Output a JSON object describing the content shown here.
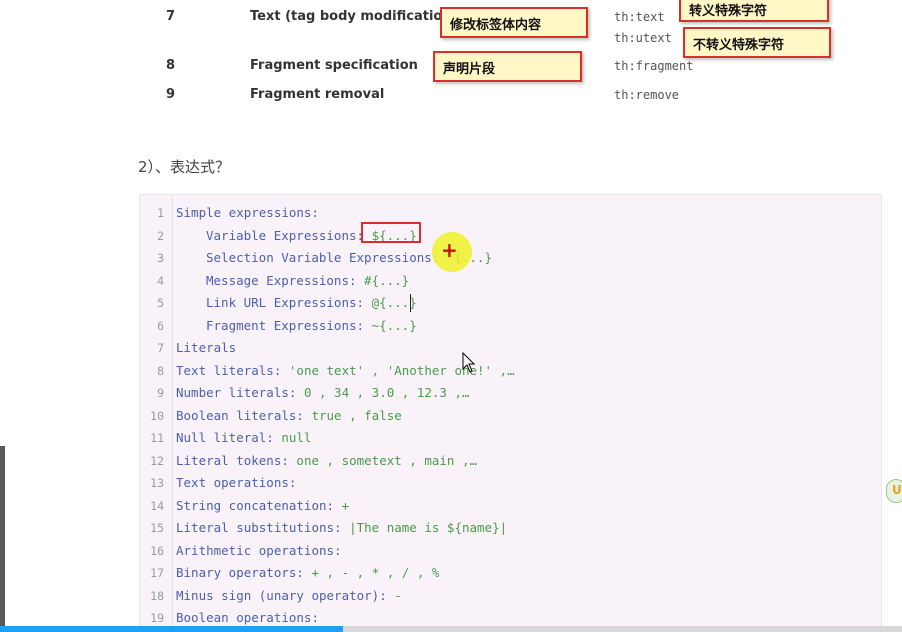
{
  "table": {
    "rows": [
      {
        "num": "7",
        "feature": "Text (tag body modification)",
        "attrs": [
          "th:text",
          "th:utext"
        ]
      },
      {
        "num": "8",
        "feature": "Fragment specification",
        "attrs": [
          "th:fragment"
        ]
      },
      {
        "num": "9",
        "feature": "Fragment removal",
        "attrs": [
          "th:remove"
        ]
      }
    ]
  },
  "annotations": {
    "modify_body": "修改标签体内容",
    "escape": "转义特殊字符",
    "no_escape": "不转义特殊字符",
    "declare_fragment": "声明片段"
  },
  "section_heading": "2）、表达式？",
  "code": {
    "lines": [
      {
        "n": "1",
        "key": "Simple expressions:",
        "val": "",
        "indent": false
      },
      {
        "n": "2",
        "key": "Variable Expressions: ",
        "val": "${...}",
        "indent": true
      },
      {
        "n": "3",
        "key": "Selection Variable Expressions: ",
        "val": "*{...}",
        "indent": true
      },
      {
        "n": "4",
        "key": "Message Expressions: ",
        "val": "#{...}",
        "indent": true
      },
      {
        "n": "5",
        "key": "Link URL Expressions: ",
        "val": "@{...}",
        "indent": true
      },
      {
        "n": "6",
        "key": "Fragment Expressions: ",
        "val": "~{...}",
        "indent": true
      },
      {
        "n": "7",
        "key": "Literals",
        "val": "",
        "indent": false
      },
      {
        "n": "8",
        "key": "Text literals: ",
        "val": "'one text' , 'Another one!' ,…",
        "indent": false
      },
      {
        "n": "9",
        "key": "Number literals: ",
        "val": "0 , 34 , 3.0 , 12.3 ,…",
        "indent": false
      },
      {
        "n": "10",
        "key": "Boolean literals: ",
        "val": "true , false",
        "indent": false
      },
      {
        "n": "11",
        "key": "Null literal: ",
        "val": "null",
        "indent": false
      },
      {
        "n": "12",
        "key": "Literal tokens: ",
        "val": "one , sometext , main ,…",
        "indent": false
      },
      {
        "n": "13",
        "key": "Text operations:",
        "val": "",
        "indent": false
      },
      {
        "n": "14",
        "key": "String concatenation: ",
        "val": "+",
        "indent": false
      },
      {
        "n": "15",
        "key": "Literal substitutions: ",
        "val": "|The name is ${name}|",
        "indent": false
      },
      {
        "n": "16",
        "key": "Arithmetic operations:",
        "val": "",
        "indent": false
      },
      {
        "n": "17",
        "key": "Binary operators: ",
        "val": "+ , - , * , / , %",
        "indent": false
      },
      {
        "n": "18",
        "key": "Minus sign (unary operator): ",
        "val": "-",
        "indent": false
      },
      {
        "n": "19",
        "key": "Boolean operations:",
        "val": "",
        "indent": false
      }
    ]
  },
  "player": {
    "progress": 0.38
  },
  "colors": {
    "accent": "#1da1f2",
    "annotation_border": "#d9302c",
    "annotation_bg": "#fff8c6",
    "code_bg": "#f9f3f9"
  }
}
